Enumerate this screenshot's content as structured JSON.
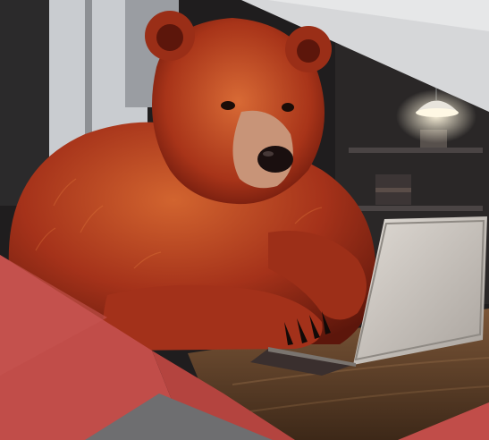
{
  "colors": {
    "office_dark": "#1c1b1c",
    "office_mid": "#3a3636",
    "window_light": "#c9ccd0",
    "top_band": "#d6d7d9",
    "bear_fur_dark": "#6e1a0d",
    "bear_fur": "#a5321a",
    "bear_fur_light": "#cf5a2d",
    "muzzle": "#c89478",
    "nose": "#1a0f0f",
    "laptop_body": "#b9b6b2",
    "laptop_screen_back": "#cfc9c2",
    "desk_wood": "#5a3c26",
    "desk_wood_light": "#7b5638",
    "overlay_red": "#c14d49",
    "overlay_red_dark": "#a63f3c",
    "overlay_grey": "#6e6e70",
    "lamp_glow": "#f2e6c9"
  },
  "icons": [
    "ceiling-lamp-icon",
    "laptop-icon"
  ]
}
